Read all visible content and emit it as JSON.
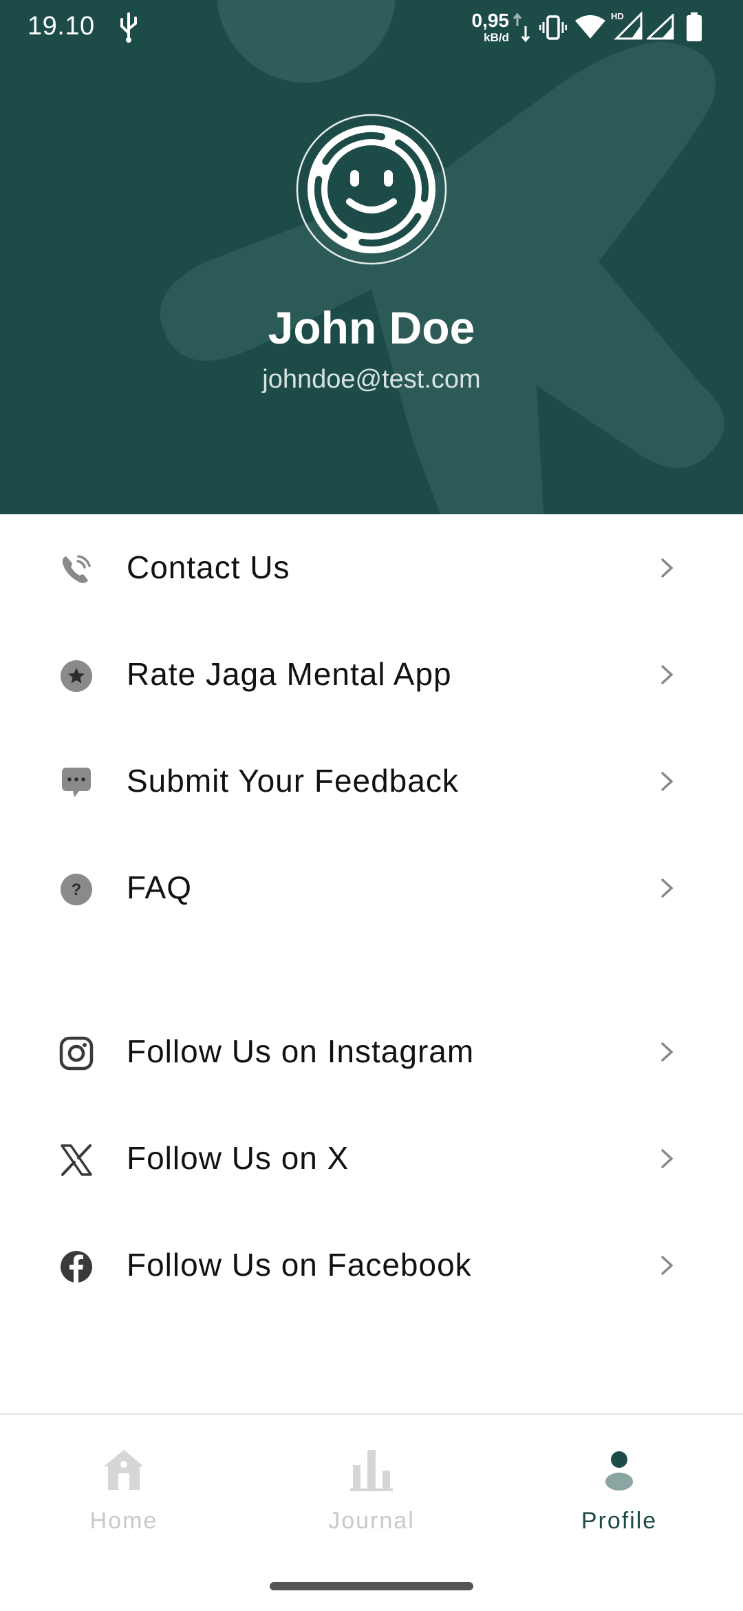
{
  "status_bar": {
    "time": "19.10",
    "net_speed_value": "0,95",
    "net_speed_unit": "kB/d",
    "icons": [
      "usb-icon",
      "data-arrows-icon",
      "vibrate-icon",
      "wifi-icon",
      "hd-signal-icon",
      "signal-icon",
      "battery-icon"
    ]
  },
  "profile": {
    "name": "John Doe",
    "email": "johndoe@test.com",
    "avatar_icon": "smiley-face-icon"
  },
  "menu": {
    "items": [
      {
        "label": "Contact Us",
        "icon": "phone-icon"
      },
      {
        "label": "Rate Jaga Mental App",
        "icon": "star-badge-icon"
      },
      {
        "label": "Submit Your Feedback",
        "icon": "chat-bubble-icon"
      },
      {
        "label": "FAQ",
        "icon": "question-circle-icon"
      },
      {
        "label": "Follow Us on Instagram",
        "icon": "instagram-icon"
      },
      {
        "label": "Follow Us on X",
        "icon": "x-logo-icon"
      },
      {
        "label": "Follow Us on Facebook",
        "icon": "facebook-icon"
      }
    ]
  },
  "bottom_nav": {
    "items": [
      {
        "label": "Home",
        "icon": "home-icon",
        "active": false
      },
      {
        "label": "Journal",
        "icon": "bar-chart-icon",
        "active": false
      },
      {
        "label": "Profile",
        "icon": "person-icon",
        "active": true
      }
    ]
  },
  "colors": {
    "header_bg": "#1d4c48",
    "accent": "#1d4c48",
    "inactive_nav": "#c9c9c9",
    "menu_icon": "#4a4a4a"
  }
}
